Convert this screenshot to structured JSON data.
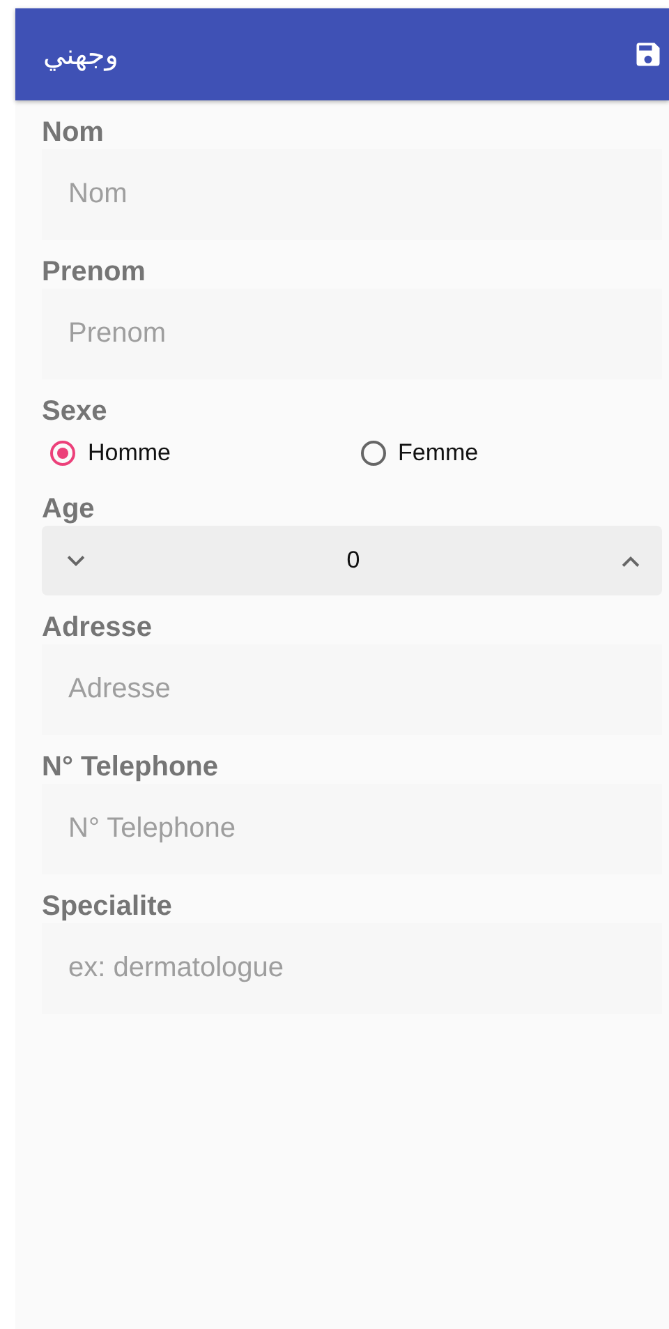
{
  "app_bar": {
    "title": "وجهني"
  },
  "fields": [
    {
      "kind": "text",
      "label": "Nom",
      "placeholder": "Nom"
    },
    {
      "kind": "text",
      "label": "Prenom",
      "placeholder": "Prenom"
    },
    {
      "kind": "radio",
      "label": "Sexe",
      "options": [
        {
          "label": "Homme",
          "selected": true
        },
        {
          "label": "Femme",
          "selected": false
        }
      ]
    },
    {
      "kind": "stepper",
      "label": "Age",
      "value": "0"
    },
    {
      "kind": "text",
      "label": "Adresse",
      "placeholder": "Adresse"
    },
    {
      "kind": "text",
      "label": "N° Telephone",
      "placeholder": "N° Telephone"
    },
    {
      "kind": "text",
      "label": "Specialite",
      "placeholder": "ex: dermatologue"
    }
  ]
}
